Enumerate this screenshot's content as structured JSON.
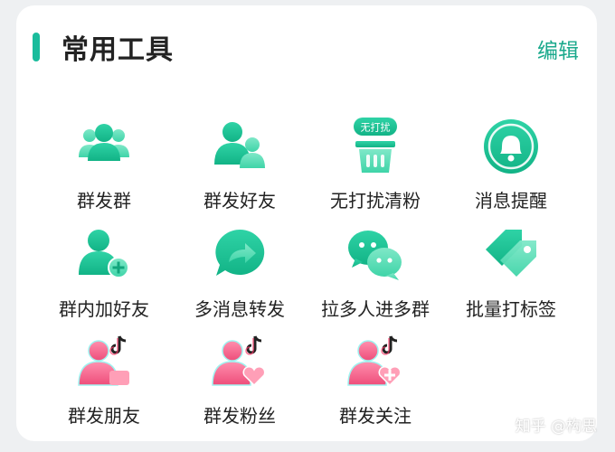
{
  "header": {
    "title": "常用工具",
    "edit_label": "编辑"
  },
  "colors": {
    "accent": "#1abc9c",
    "pink": "#f05a7e"
  },
  "tools": [
    {
      "label": "群发群",
      "icon": "group-icon"
    },
    {
      "label": "群发好友",
      "icon": "friends-icon"
    },
    {
      "label": "无打扰清粉",
      "icon": "trash-icon",
      "badge": "无打扰"
    },
    {
      "label": "消息提醒",
      "icon": "bell-icon"
    },
    {
      "label": "群内加好友",
      "icon": "add-friend-icon"
    },
    {
      "label": "多消息转发",
      "icon": "forward-icon"
    },
    {
      "label": "拉多人进多群",
      "icon": "chat-icon"
    },
    {
      "label": "批量打标签",
      "icon": "tag-icon"
    },
    {
      "label": "群发朋友",
      "icon": "douyin-friend-icon"
    },
    {
      "label": "群发粉丝",
      "icon": "douyin-fans-icon"
    },
    {
      "label": "群发关注",
      "icon": "douyin-follow-icon"
    }
  ],
  "watermark": "知乎 @构思"
}
